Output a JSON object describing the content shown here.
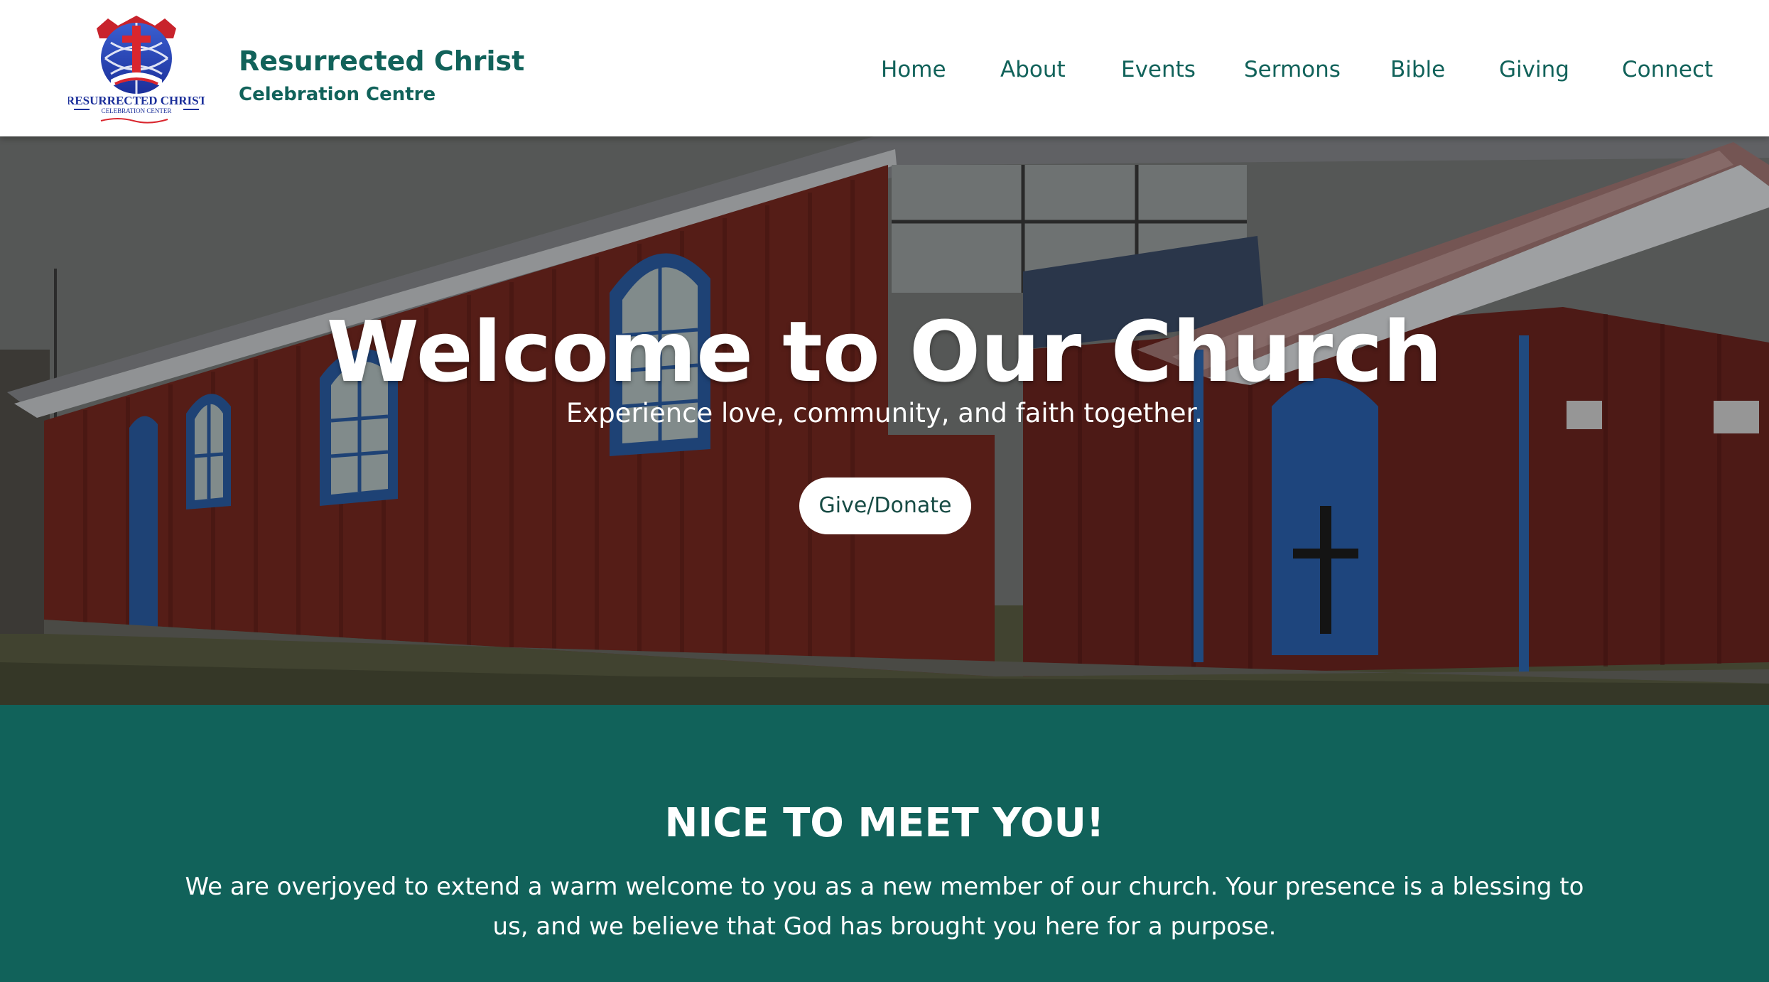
{
  "site": {
    "brand_title": "Resurrected Christ",
    "brand_subtitle": "Celebration Centre",
    "logo": {
      "icon": "church-logo-globe-cross",
      "text_main": "RESURRECTED CHRIST",
      "text_sub": "CELEBRATION CENTER"
    }
  },
  "nav": {
    "items": [
      {
        "label": "Home"
      },
      {
        "label": "About"
      },
      {
        "label": "Events"
      },
      {
        "label": "Sermons"
      },
      {
        "label": "Bible"
      },
      {
        "label": "Giving"
      },
      {
        "label": "Connect"
      }
    ]
  },
  "hero": {
    "title": "Welcome to Our Church",
    "subtitle": "Experience love, community, and faith together.",
    "button_label": "Give/Donate",
    "background": "photo of red corrugated-iron church building with blue windows and doors"
  },
  "welcome": {
    "title": "NICE TO MEET YOU!",
    "text": "We are overjoyed to extend a warm welcome to you as a new member of our church. Your presence is a blessing to us, and we believe that God has brought you here for a purpose."
  },
  "colors": {
    "brand_green": "#11625a",
    "white": "#ffffff",
    "button_text": "#174b44"
  }
}
